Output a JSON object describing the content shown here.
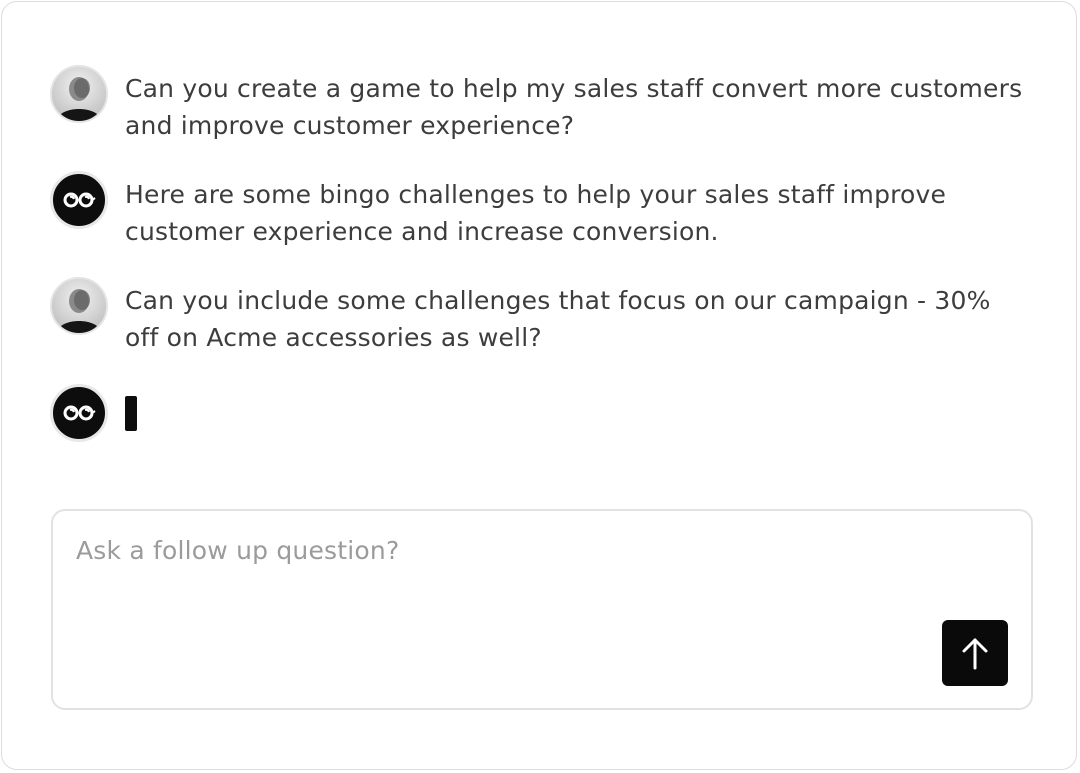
{
  "chat": {
    "messages": [
      {
        "role": "user",
        "avatar_icon": "user-photo-avatar",
        "text": "Can you create a game to help my sales staff convert more customers and improve customer experience?"
      },
      {
        "role": "assistant",
        "avatar_icon": "bot-glasses-icon",
        "text": "Here are some bingo challenges to help your sales staff improve customer experience and increase conversion."
      },
      {
        "role": "user",
        "avatar_icon": "user-photo-avatar",
        "text": "Can you include some challenges that focus on our campaign - 30% off on Acme accessories as well?"
      },
      {
        "role": "assistant",
        "avatar_icon": "bot-glasses-icon",
        "state": "typing"
      }
    ]
  },
  "composer": {
    "placeholder": "Ask a follow up question?",
    "send_icon": "arrow-up-icon"
  },
  "colors": {
    "text": "#3d3d3d",
    "placeholder": "#9b9b9b",
    "accent": "#0a0a0a",
    "border": "#e2e2e2"
  }
}
